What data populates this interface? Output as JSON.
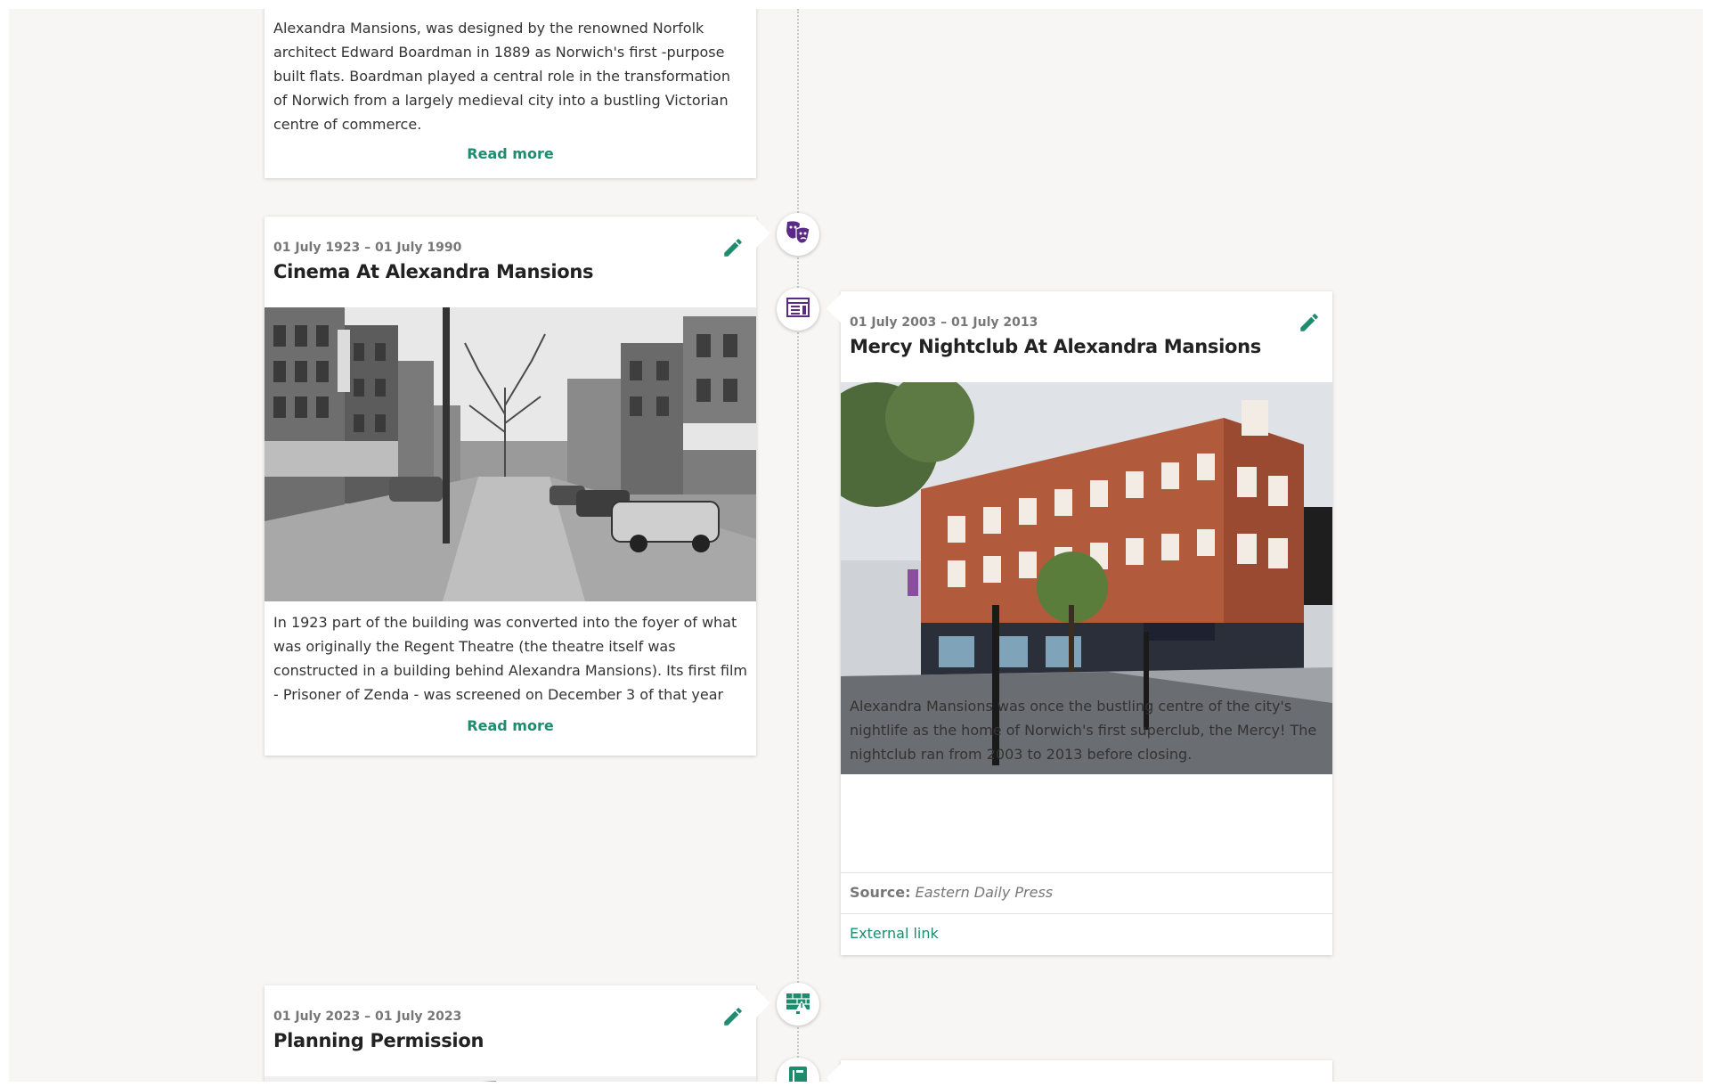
{
  "colors": {
    "accent": "#1e8c6e",
    "background": "#f7f6f4",
    "icon_purple": "#5b2a86"
  },
  "card1": {
    "text": [
      "Alexandra Mansions, was designed by the renowned Norfolk",
      "architect Edward Boardman in 1889 as Norwich's first -purpose",
      "built flats.  Boardman played a central role in the transformation",
      "of Norwich from a largely medieval city into a bustling Victorian",
      "centre of commerce."
    ],
    "read_more": "Read more"
  },
  "card2": {
    "date": "01 July 1923 – 01 July 1990",
    "title": "Cinema At Alexandra Mansions",
    "image_alt": "Black and white street view with ABC cinema sign and parked cars",
    "text": [
      "In 1923 part of the building was converted into the foyer of what",
      "was originally the Regent Theatre (the theatre itself was",
      "constructed in a building behind Alexandra Mansions).  Its first film",
      "- Prisoner of Zenda - was screened on December 3 of that year"
    ],
    "read_more": "Read more",
    "icon": "theatre-masks-icon"
  },
  "card3": {
    "date": "01 July 2003 – 01 July 2013",
    "title": "Mercy Nightclub At Alexandra Mansions",
    "image_alt": "Red brick Victorian mansion block on a street corner",
    "text": [
      "Alexandra Mansions was once the bustling centre of the city's",
      "nightlife as the home of Norwich's first superclub, the Mercy! The",
      "nightclub ran from 2003 to 2013 before closing."
    ],
    "source_label": "Source:",
    "source_value": "Eastern Daily Press",
    "external_link": "External link",
    "icon": "document-list-icon"
  },
  "card4": {
    "date": "01 July 2023 – 01 July 2023",
    "title": "Planning Permission",
    "icon": "building-permit-icon"
  },
  "card5": {
    "icon": "book-icon"
  }
}
